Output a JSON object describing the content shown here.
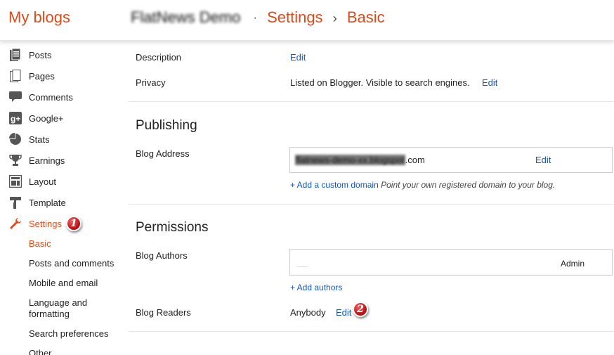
{
  "header": {
    "brand": "My blogs",
    "blog_name": "FlatNews Demo",
    "crumb_dot": "·",
    "crumb_settings": "Settings",
    "crumb_arrow": "›",
    "crumb_basic": "Basic"
  },
  "sidebar": {
    "items": [
      {
        "label": "Posts",
        "icon": "posts-icon"
      },
      {
        "label": "Pages",
        "icon": "pages-icon"
      },
      {
        "label": "Comments",
        "icon": "comments-icon"
      },
      {
        "label": "Google+",
        "icon": "google-plus-icon"
      },
      {
        "label": "Stats",
        "icon": "stats-icon"
      },
      {
        "label": "Earnings",
        "icon": "trophy-icon"
      },
      {
        "label": "Layout",
        "icon": "layout-icon"
      },
      {
        "label": "Template",
        "icon": "template-icon"
      },
      {
        "label": "Settings",
        "icon": "wrench-icon"
      }
    ],
    "settings_badge": "1",
    "sub_items": [
      "Basic",
      "Posts and comments",
      "Mobile and email",
      "Language and\nformatting",
      "Search preferences",
      "Other"
    ]
  },
  "basic": {
    "description_label": "Description",
    "description_edit": "Edit",
    "privacy_label": "Privacy",
    "privacy_value": "Listed on Blogger. Visible to search engines.",
    "privacy_edit": "Edit"
  },
  "publishing": {
    "title": "Publishing",
    "address_label": "Blog Address",
    "address_blurred": "flatnews-demo-xx.blogspot",
    "address_suffix": ".com",
    "address_edit": "Edit",
    "custom_domain_link": "+ Add a custom domain",
    "custom_domain_hint": "Point your own registered domain to your blog."
  },
  "permissions": {
    "title": "Permissions",
    "authors_label": "Blog Authors",
    "author_role": "Admin",
    "add_authors": "+ Add authors",
    "readers_label": "Blog Readers",
    "readers_value": "Anybody",
    "readers_edit": "Edit",
    "readers_badge": "2"
  },
  "colors": {
    "accent": "#dd4b19",
    "link": "#1155cc",
    "badge": "#cc1111"
  }
}
